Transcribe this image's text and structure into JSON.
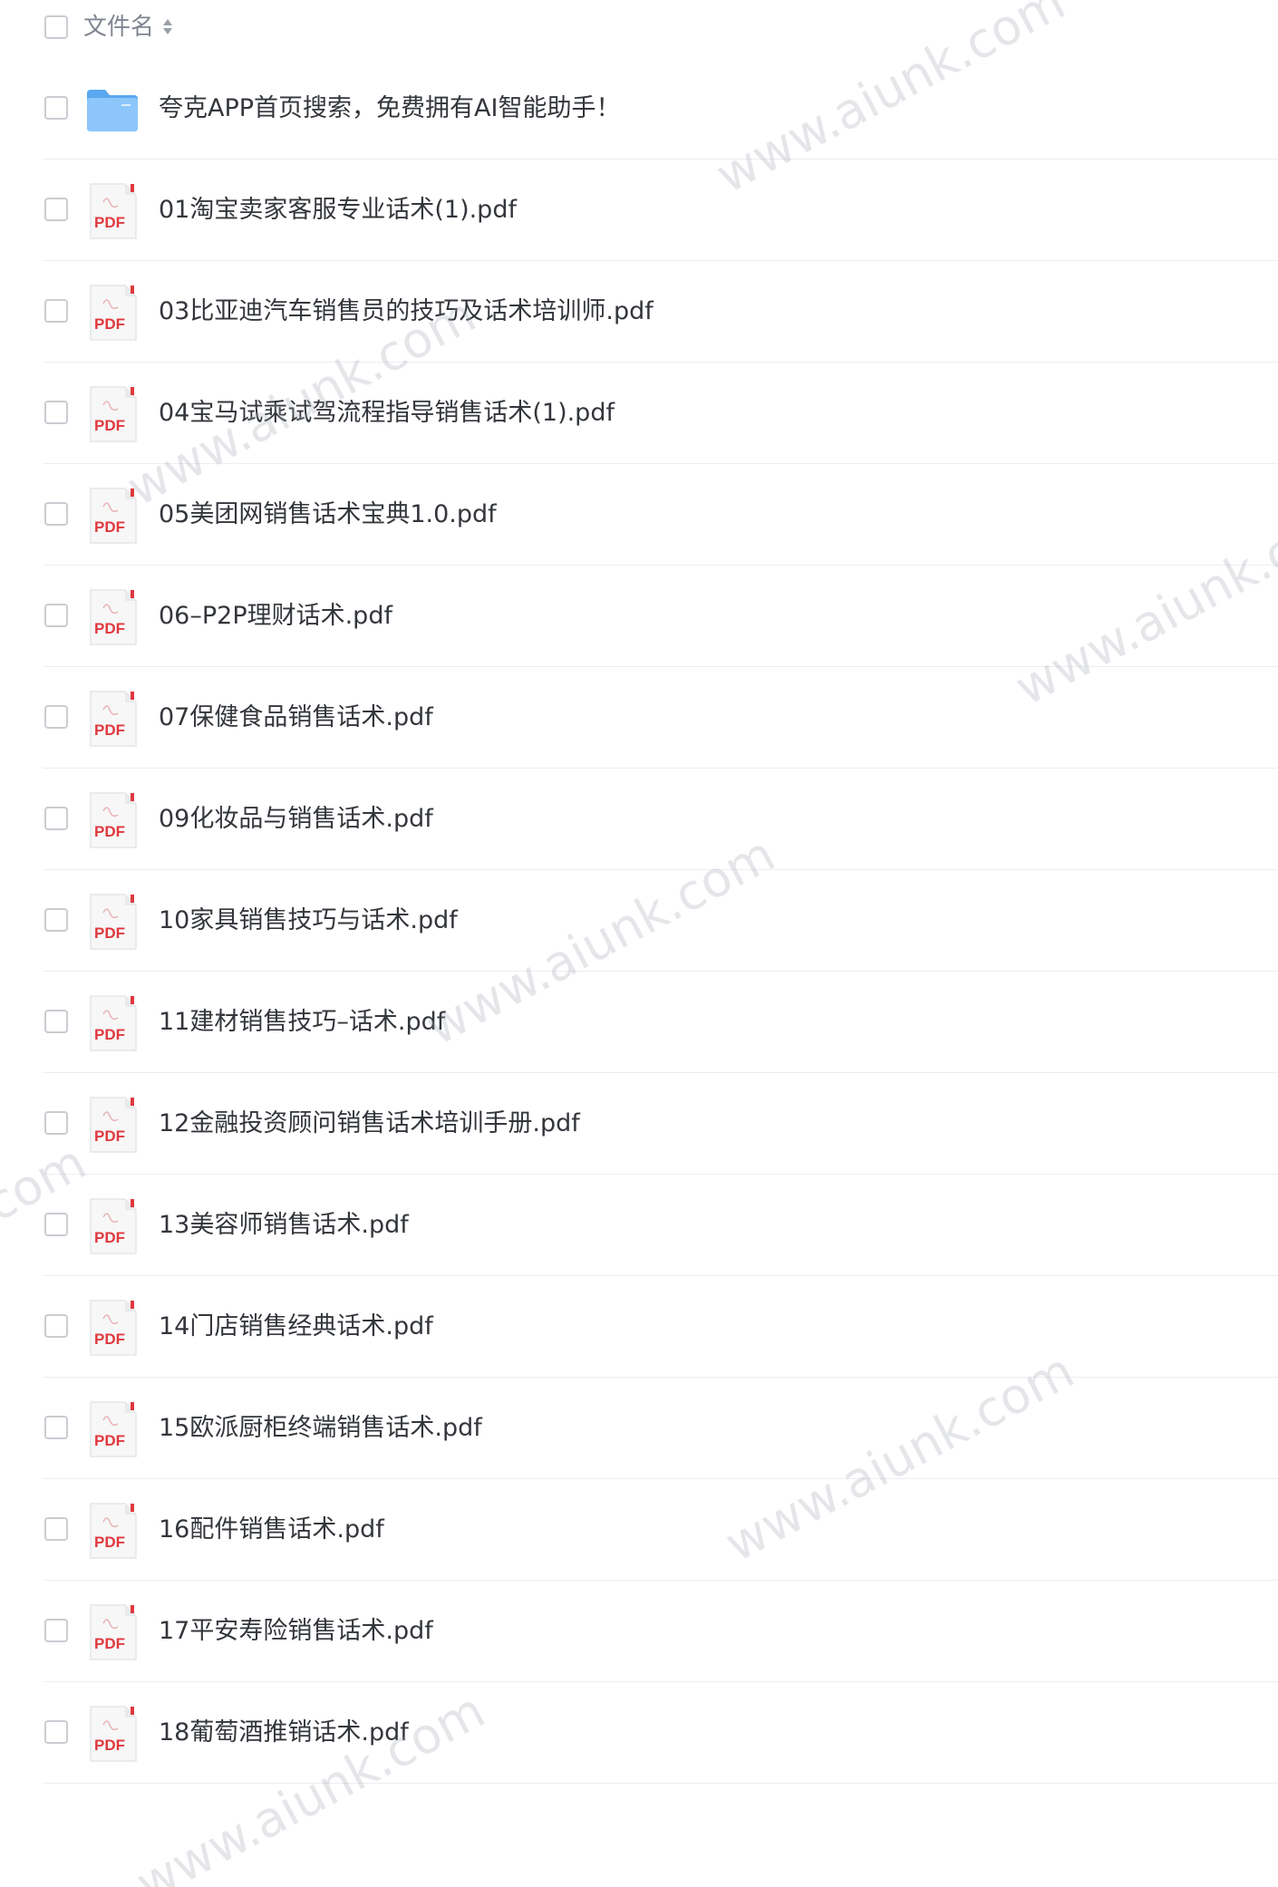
{
  "header": {
    "column_label": "文件名",
    "sort_icon": "sort-icon"
  },
  "files": [
    {
      "name": "夸克APP首页搜索，免费拥有AI智能助手！",
      "type": "folder",
      "icon": "folder-icon"
    },
    {
      "name": "01淘宝卖家客服专业话术(1).pdf",
      "type": "pdf",
      "icon": "pdf-icon"
    },
    {
      "name": "03比亚迪汽车销售员的技巧及话术培训师.pdf",
      "type": "pdf",
      "icon": "pdf-icon"
    },
    {
      "name": "04宝马试乘试驾流程指导销售话术(1).pdf",
      "type": "pdf",
      "icon": "pdf-icon"
    },
    {
      "name": "05美团网销售话术宝典1.0.pdf",
      "type": "pdf",
      "icon": "pdf-icon"
    },
    {
      "name": "06–P2P理财话术.pdf",
      "type": "pdf",
      "icon": "pdf-icon"
    },
    {
      "name": "07保健食品销售话术.pdf",
      "type": "pdf",
      "icon": "pdf-icon"
    },
    {
      "name": "09化妆品与销售话术.pdf",
      "type": "pdf",
      "icon": "pdf-icon"
    },
    {
      "name": "10家具销售技巧与话术.pdf",
      "type": "pdf",
      "icon": "pdf-icon"
    },
    {
      "name": "11建材销售技巧–话术.pdf",
      "type": "pdf",
      "icon": "pdf-icon"
    },
    {
      "name": "12金融投资顾问销售话术培训手册.pdf",
      "type": "pdf",
      "icon": "pdf-icon"
    },
    {
      "name": "13美容师销售话术.pdf",
      "type": "pdf",
      "icon": "pdf-icon"
    },
    {
      "name": "14门店销售经典话术.pdf",
      "type": "pdf",
      "icon": "pdf-icon"
    },
    {
      "name": "15欧派厨柜终端销售话术.pdf",
      "type": "pdf",
      "icon": "pdf-icon"
    },
    {
      "name": "16配件销售话术.pdf",
      "type": "pdf",
      "icon": "pdf-icon"
    },
    {
      "name": "17平安寿险销售话术.pdf",
      "type": "pdf",
      "icon": "pdf-icon"
    },
    {
      "name": "18葡萄酒推销话术.pdf",
      "type": "pdf",
      "icon": "pdf-icon"
    }
  ],
  "pdf_icon_label": "PDF",
  "watermark_text": "www.aiunk.com",
  "colors": {
    "pdf_red": "#e0393e",
    "folder_blue": "#6cb4f5",
    "divider": "#eceef1"
  }
}
